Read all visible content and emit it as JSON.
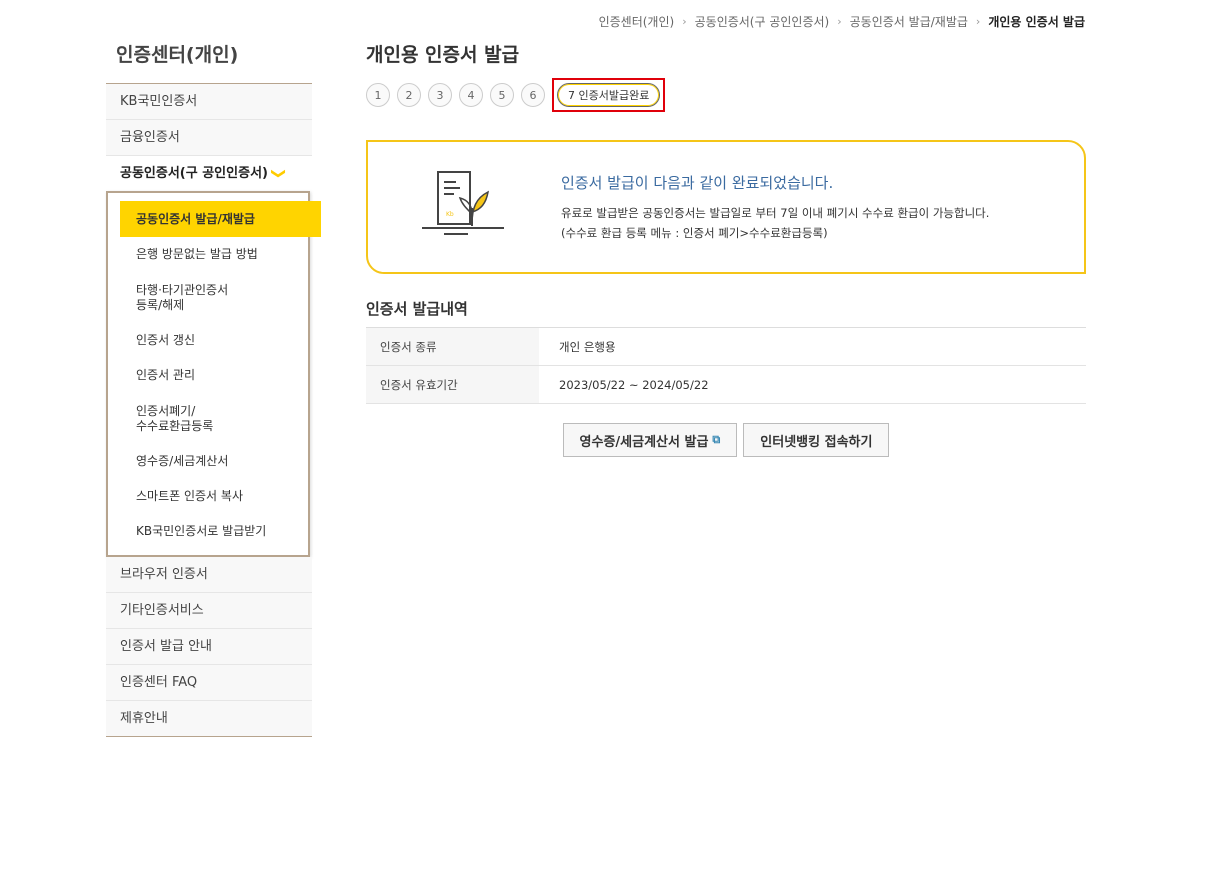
{
  "breadcrumb": {
    "items": [
      "인증센터(개인)",
      "공동인증서(구 공인인증서)",
      "공동인증서 발급/재발급"
    ],
    "current": "개인용 인증서 발급",
    "sep": "›"
  },
  "sidebar": {
    "title": "인증센터(개인)",
    "top_items": [
      "KB국민인증서",
      "금융인증서"
    ],
    "active": "공동인증서(구 공인인증서)",
    "chevron": "❯",
    "sub_items": {
      "s0": "공동인증서 발급/재발급",
      "s1": "은행 방문없는 발급 방법",
      "s2a": "타행·타기관인증서",
      "s2b": "등록/해제",
      "s3": "인증서 갱신",
      "s4": "인증서 관리",
      "s5a": "인증서폐기/",
      "s5b": "수수료환급등록",
      "s6": "영수증/세금계산서",
      "s7": "스마트폰 인증서 복사",
      "s8": "KB국민인증서로 발급받기"
    },
    "bottom_items": [
      "브라우저 인증서",
      "기타인증서비스",
      "인증서 발급 안내",
      "인증센터 FAQ",
      "제휴안내"
    ]
  },
  "main": {
    "title": "개인용 인증서 발급",
    "steps": [
      "1",
      "2",
      "3",
      "4",
      "5",
      "6"
    ],
    "current_step": "7 인증서발급완료",
    "result": {
      "headline": "인증서 발급이 다음과 같이 완료되었습니다.",
      "desc1": "유료로 발급받은 공동인증서는 발급일로 부터 7일 이내 폐기시 수수료 환급이 가능합니다.",
      "desc2": "(수수료 환급 등록 메뉴 : 인증서 폐기>수수료환급등록)"
    },
    "section_title": "인증서 발급내역",
    "table": [
      {
        "label": "인증서 종류",
        "value": "개인 은행용"
      },
      {
        "label": "인증서 유효기간",
        "value": "2023/05/22 ~ 2024/05/22"
      }
    ],
    "buttons": {
      "receipt": "영수증/세금계산서 발급",
      "receipt_icon": "external-link-icon",
      "ext_glyph": "⧉",
      "banking": "인터넷뱅킹 접속하기"
    }
  },
  "colors": {
    "accent": "#ffd400",
    "border_box": "#f5c518",
    "headline": "#3a6aa0",
    "highlight": "#e0000a"
  }
}
